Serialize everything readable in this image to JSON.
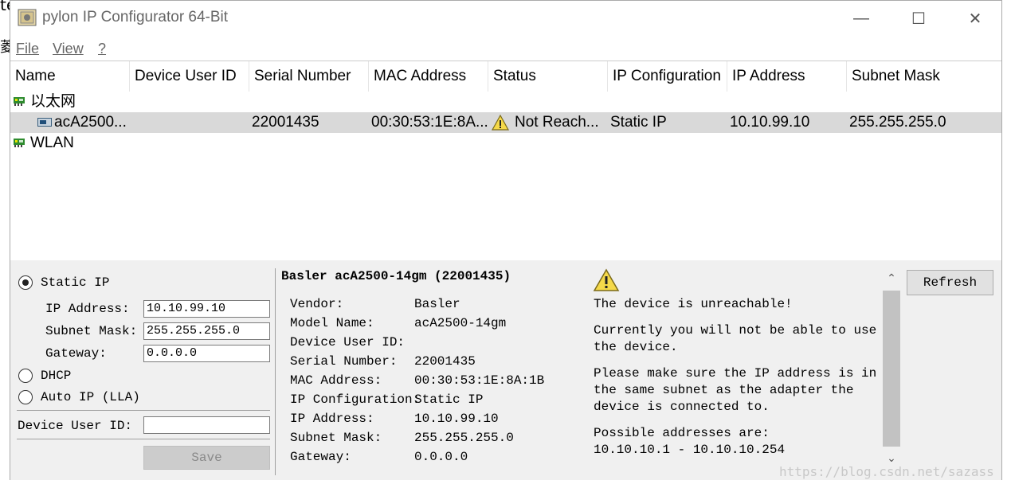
{
  "background": {
    "glyph_top": "te",
    "glyph_left": "菱"
  },
  "window": {
    "title": "pylon IP Configurator 64-Bit",
    "controls": {
      "minimize": "—",
      "maximize": "☐",
      "close": "✕"
    }
  },
  "menu": {
    "items": [
      "File",
      "View",
      "?"
    ]
  },
  "table": {
    "columns": [
      "Name",
      "Device User ID",
      "Serial Number",
      "MAC Address",
      "Status",
      "IP Configuration",
      "IP Address",
      "Subnet Mask"
    ],
    "groups": [
      {
        "name": "以太网"
      },
      {
        "name": "WLAN"
      }
    ],
    "device_row": {
      "name": "acA2500...",
      "device_user_id": "",
      "serial_number": "22001435",
      "mac_address": "00:30:53:1E:8A...",
      "status": "Not Reach...",
      "ip_configuration": "Static IP",
      "ip_address": "10.10.99.10",
      "subnet_mask": "255.255.255.0"
    }
  },
  "config": {
    "static_ip_label": "Static IP",
    "ip_address_label": "IP Address:",
    "ip_address_value": "10.10.99.10",
    "subnet_mask_label": "Subnet Mask:",
    "subnet_mask_value": "255.255.255.0",
    "gateway_label": "Gateway:",
    "gateway_value": "0.0.0.0",
    "dhcp_label": "DHCP",
    "auto_ip_label": "Auto IP (LLA)",
    "device_user_id_label": "Device User ID:",
    "device_user_id_value": "",
    "save_label": "Save",
    "selected_mode": "Static IP"
  },
  "details": {
    "heading": "Basler acA2500-14gm (22001435)",
    "rows": [
      {
        "label": "Vendor:",
        "value": "Basler"
      },
      {
        "label": "Model Name:",
        "value": "acA2500-14gm"
      },
      {
        "label": "Device User ID:",
        "value": ""
      },
      {
        "label": "Serial Number:",
        "value": "22001435"
      },
      {
        "label": "MAC Address:",
        "value": "00:30:53:1E:8A:1B"
      },
      {
        "label": "IP Configuration:",
        "value": "Static IP"
      },
      {
        "label": "IP Address:",
        "value": "10.10.99.10"
      },
      {
        "label": "Subnet Mask:",
        "value": "255.255.255.0"
      },
      {
        "label": "Gateway:",
        "value": "0.0.0.0"
      }
    ]
  },
  "warning": {
    "line1": "The device is unreachable!",
    "para2_l1": "Currently you will not be able to use",
    "para2_l2": "the device.",
    "para3_l1": "Please make sure the IP address is in",
    "para3_l2": "the same subnet as the adapter the",
    "para3_l3": "device is connected to.",
    "para4_l1": "Possible addresses are:",
    "para4_l2": "10.10.10.1 - 10.10.10.254"
  },
  "refresh_label": "Refresh",
  "watermark": "https://blog.csdn.net/sazass",
  "colors": {
    "selected_row": "#d9d9d9",
    "warning_yellow": "#f5d94a",
    "network_green": "#2e8b2e"
  }
}
